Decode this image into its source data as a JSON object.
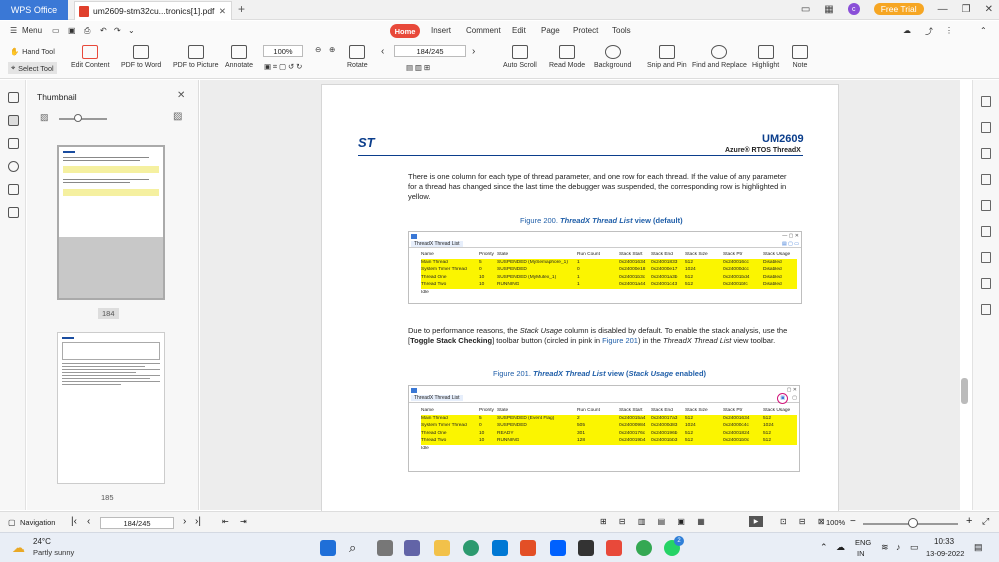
{
  "window": {
    "app_name": "WPS Office",
    "doc_tab": "um2609-stm32cu...tronics[1].pdf",
    "trial": "Free Trial",
    "avatar_letter": "c"
  },
  "menu": {
    "menu_label": "Menu",
    "items": [
      "Home",
      "Insert",
      "Comment",
      "Edit",
      "Page",
      "Protect",
      "Tools"
    ],
    "active": "Home"
  },
  "ribbon": {
    "hand_tool": "Hand Tool",
    "select_tool": "Select Tool",
    "edit_content": "Edit Content",
    "pdf_to_word": "PDF to Word",
    "pdf_to_picture": "PDF to Picture",
    "annotate": "Annotate",
    "zoom": "100%",
    "rotate": "Rotate",
    "page_field": "184/245",
    "auto_scroll": "Auto Scroll",
    "read_mode": "Read Mode",
    "background": "Background",
    "snip_and_pin": "Snip and Pin",
    "find_and_replace": "Find and Replace",
    "highlight": "Highlight",
    "note": "Note"
  },
  "thumbnail_panel": {
    "title": "Thumbnail",
    "page_a": "184",
    "page_b": "185"
  },
  "document": {
    "doc_id": "UM2609",
    "doc_subtitle": "Azure® RTOS ThreadX",
    "para1": "There is one column for each type of thread parameter, and one row for each thread. If the value of any parameter for a thread has changed since the last time the debugger was suspended, the corresponding row is highlighted in yellow.",
    "fig200_num": "Figure 200.",
    "fig200_title": "ThreadX Thread List",
    "fig200_tail": "view (default)",
    "para2_a": "Due to performance reasons, the ",
    "para2_b": "Stack Usage",
    "para2_c": " column is disabled by default. To enable the stack analysis, use the [",
    "para2_d": "Toggle Stack Checking",
    "para2_e": "] toolbar button (circled in pink in ",
    "para2_f": "Figure 201",
    "para2_g": ") in the ",
    "para2_h": "ThreadX Thread List",
    "para2_i": " view toolbar.",
    "fig201_num": "Figure 201.",
    "fig201_title": "ThreadX Thread List",
    "fig201_mid": "view (",
    "fig201_su": "Stack Usage",
    "fig201_tail": " enabled)",
    "tab_label": "ThreadX Thread List",
    "t1_headers": [
      "Name",
      "Priority",
      "State",
      "Run Count",
      "Stack Start",
      "Stack End",
      "Stack Size",
      "Stack Ptr",
      "Stack Usage"
    ],
    "t1_rows": [
      [
        "Main Thread",
        "5",
        "SUSPENDED (MySemaphore_1)",
        "1",
        "0x24001634",
        "0x24001833",
        "512",
        "0x240016cc",
        "Disabled"
      ],
      [
        "System Timer Thread",
        "0",
        "SUSPENDED",
        "0",
        "0x24000e18",
        "0x24000e17",
        "1024",
        "0x24000dcc",
        "Disabled"
      ],
      [
        "Thread One",
        "10",
        "SUSPENDED (MyMutex_1)",
        "1",
        "0x24001b3c",
        "0x24001a3b",
        "512",
        "0x24001bd4",
        "Disabled"
      ],
      [
        "Thread Two",
        "10",
        "RUNNING",
        "1",
        "0x24001a44",
        "0x24001c43",
        "512",
        "0x24001bfc",
        "Disabled"
      ],
      [
        "Idle",
        "",
        "",
        "",
        "",
        "",
        "",
        "",
        ""
      ]
    ],
    "t2_headers": [
      "Name",
      "Priority",
      "State",
      "Run Count",
      "Stack Start",
      "Stack End",
      "Stack Size",
      "Stack Ptr",
      "Stack Usage"
    ],
    "t2_rows": [
      [
        "Main Thread",
        "5",
        "SUSPENDED (Event Flag)",
        "2",
        "0x240015a4",
        "0x240017a3",
        "512",
        "0x24001634",
        "512"
      ],
      [
        "System Timer Thread",
        "0",
        "SUSPENDED",
        "505",
        "0x24000984",
        "0x24000d83",
        "1024",
        "0x24000c4c",
        "1024"
      ],
      [
        "Thread One",
        "10",
        "READY",
        "301",
        "0x2400176c",
        "0x2400196b",
        "512",
        "0x24001824",
        "512"
      ],
      [
        "Thread Two",
        "10",
        "RUNNING",
        "128",
        "0x240019b4",
        "0x24001bb3",
        "512",
        "0x24001b0c",
        "512"
      ],
      [
        "Idle",
        "",
        "",
        "",
        "",
        "",
        "",
        "",
        ""
      ]
    ]
  },
  "status": {
    "navigation": "Navigation",
    "page_field": "184/245",
    "zoom": "100%"
  },
  "taskbar": {
    "temp": "24°C",
    "weather": "Partly sunny",
    "lang": "ENG",
    "region": "IN",
    "time": "10:33",
    "date": "13-09-2022",
    "badge": "2"
  },
  "colors": {
    "accent": "#e8493a",
    "wps_blue": "#3a78d6",
    "highlight": "#fbf500",
    "st_blue": "#0b3e8c",
    "fig_caption": "#1f5ea8"
  }
}
